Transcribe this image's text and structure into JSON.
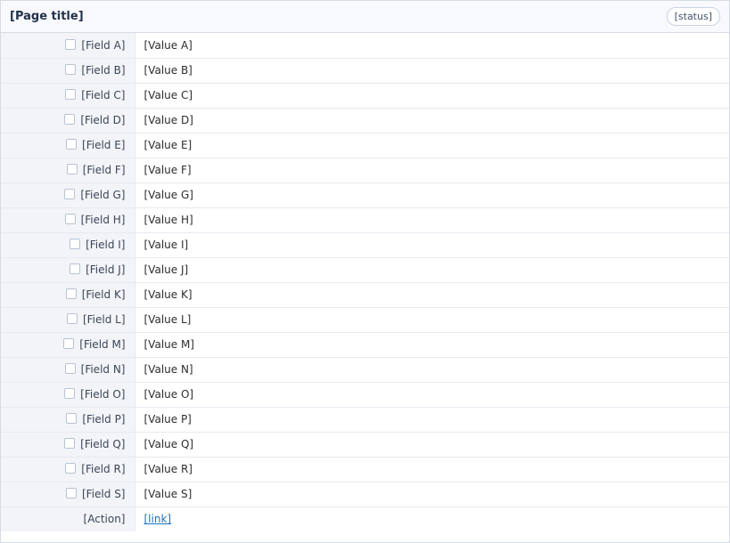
{
  "header": {
    "title": "[Page title]",
    "badge": "[status]"
  },
  "rows": [
    {
      "label": "[Field A]",
      "value": "[Value A]"
    },
    {
      "label": "[Field B]",
      "value": "[Value B]"
    },
    {
      "label": "[Field C]",
      "value": "[Value C]"
    },
    {
      "label": "[Field D]",
      "value": "[Value D]"
    },
    {
      "label": "[Field E]",
      "value": "[Value E]"
    },
    {
      "label": "[Field F]",
      "value": "[Value F]"
    },
    {
      "label": "[Field G]",
      "value": "[Value G]"
    },
    {
      "label": "[Field H]",
      "value": "[Value H]"
    },
    {
      "label": "[Field I]",
      "value": "[Value I]"
    },
    {
      "label": "[Field J]",
      "value": "[Value J]"
    },
    {
      "label": "[Field K]",
      "value": "[Value K]"
    },
    {
      "label": "[Field L]",
      "value": "[Value L]"
    },
    {
      "label": "[Field M]",
      "value": "[Value M]"
    },
    {
      "label": "[Field N]",
      "value": "[Value N]"
    },
    {
      "label": "[Field O]",
      "value": "[Value O]"
    },
    {
      "label": "[Field P]",
      "value": "[Value P]"
    },
    {
      "label": "[Field Q]",
      "value": "[Value Q]"
    },
    {
      "label": "[Field R]",
      "value": "[Value R]"
    },
    {
      "label": "[Field S]",
      "value": "[Value S]"
    }
  ],
  "footer": {
    "label": "[Action]",
    "link_text": "[link]"
  }
}
